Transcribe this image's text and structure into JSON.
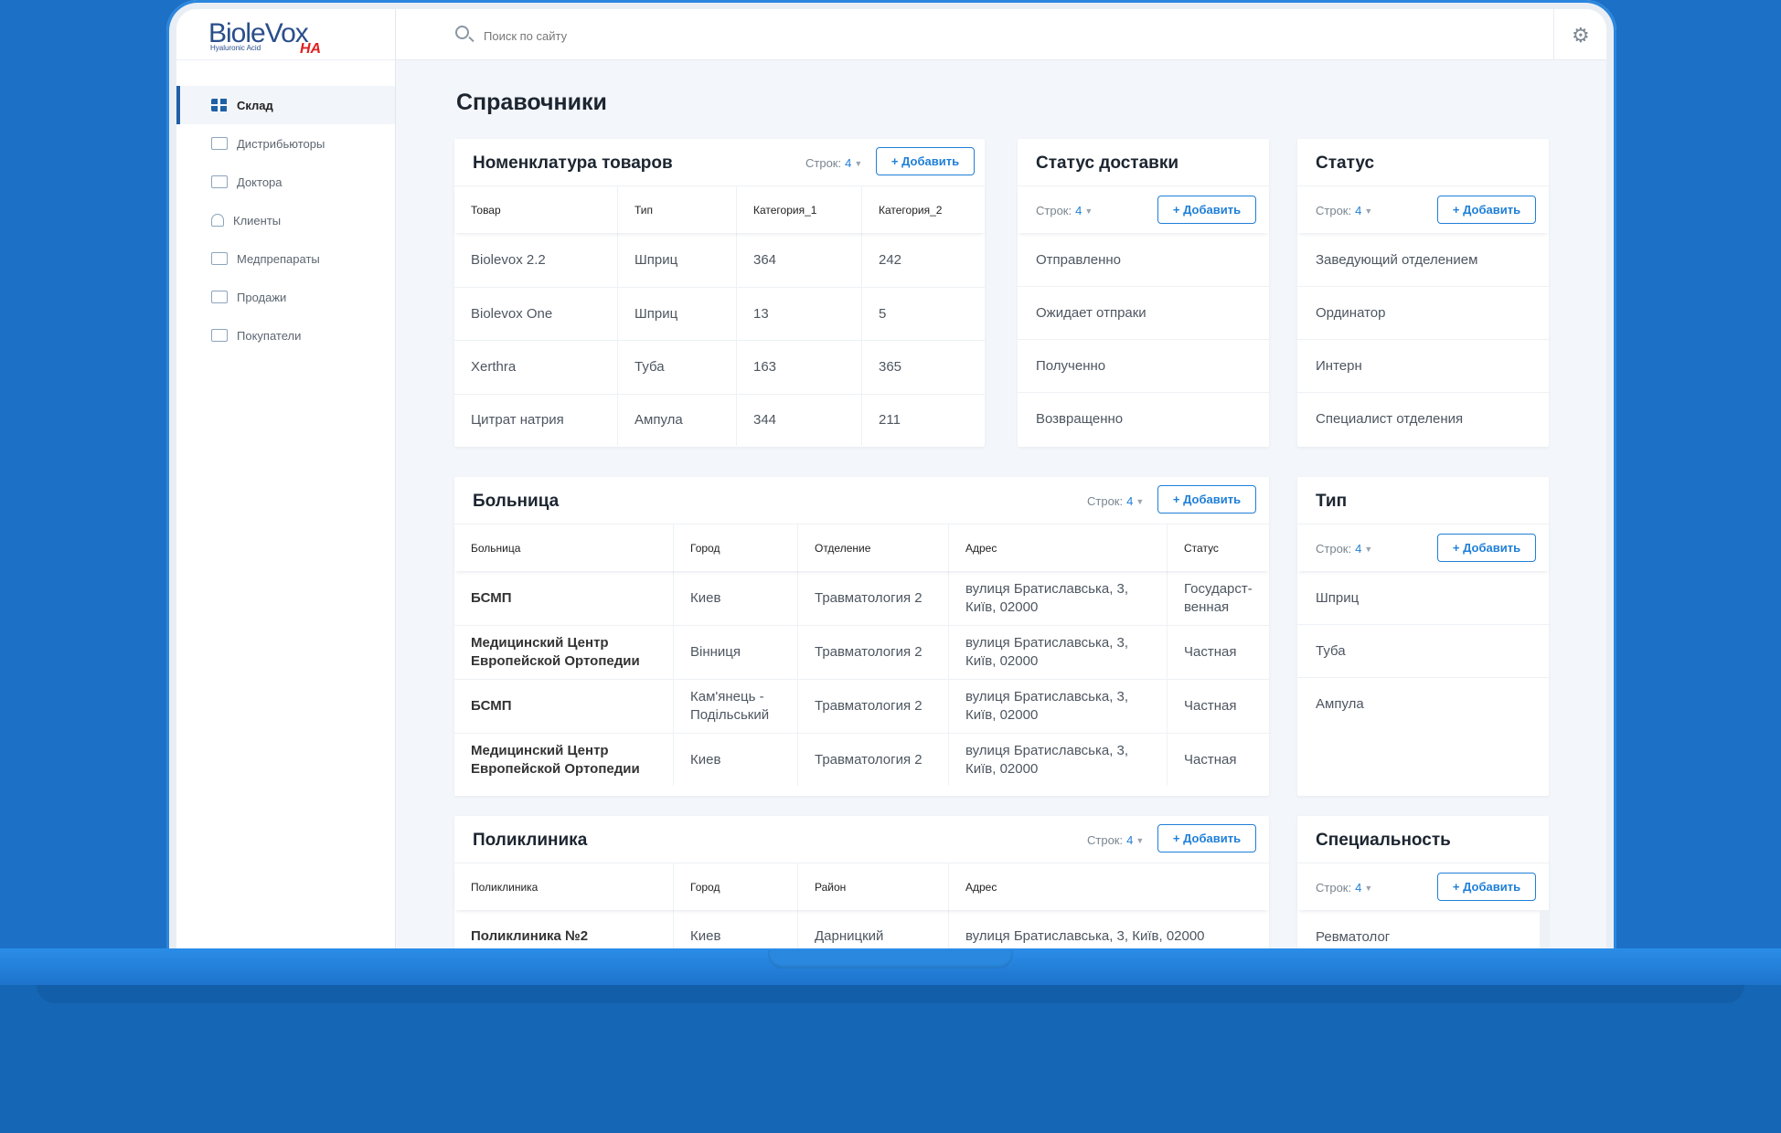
{
  "logo": {
    "main": "BioleVox",
    "sub": "Hyaluronic Acid",
    "ha": "HA"
  },
  "search": {
    "placeholder": "Поиск по сайту"
  },
  "sidebar": {
    "items": [
      {
        "label": "Склад",
        "icon": "grid-icon"
      },
      {
        "label": "Дистрибьюторы",
        "icon": "list-icon"
      },
      {
        "label": "Доктора",
        "icon": "mail-icon"
      },
      {
        "label": "Клиенты",
        "icon": "user-icon"
      },
      {
        "label": "Медпрепараты",
        "icon": "chat-icon"
      },
      {
        "label": "Продажи",
        "icon": "columns-icon"
      },
      {
        "label": "Покупатели",
        "icon": "columns-icon"
      }
    ]
  },
  "page_title": "Справочники",
  "common": {
    "rows_label": "Строк:",
    "rows_value": "4",
    "add_label": "+ Добавить"
  },
  "nomenclature": {
    "title": "Номенклатура товаров",
    "columns": [
      "Товар",
      "Тип",
      "Категория_1",
      "Категория_2"
    ],
    "rows": [
      [
        "Biolevox 2.2",
        "Шприц",
        "364",
        "242"
      ],
      [
        "Biolevox One",
        "Шприц",
        "13",
        "5"
      ],
      [
        "Xerthra",
        "Туба",
        "163",
        "365"
      ],
      [
        "Цитрат натрия",
        "Ампула",
        "344",
        "211"
      ]
    ]
  },
  "delivery_status": {
    "title": "Статус доставки",
    "items": [
      "Отправленно",
      "Ожидает отпраки",
      "Полученно",
      "Возвращенно"
    ]
  },
  "status": {
    "title": "Статус",
    "items": [
      "Заведующий отделением",
      "Ординатор",
      "Интерн",
      "Специалист отделения"
    ]
  },
  "hospital": {
    "title": "Больница",
    "columns": [
      "Больница",
      "Город",
      "Отделение",
      "Адрес",
      "Статус"
    ],
    "rows": [
      [
        "БСМП",
        "Киев",
        "Травматология 2",
        "вулиця Братиславська, 3, Київ, 02000",
        "Государст-венная"
      ],
      [
        "Медицинский Центр Европейской Ортопедии",
        "Вінниця",
        "Травматология 2",
        "вулиця Братиславська, 3, Київ, 02000",
        "Частная"
      ],
      [
        "БСМП",
        "Кам'янець - Подільський",
        "Травматология 2",
        "вулиця Братиславська, 3, Київ, 02000",
        "Частная"
      ],
      [
        "Медицинский Центр Европейской Ортопедии",
        "Киев",
        "Травматология 2",
        "вулиця Братиславська, 3, Київ, 02000",
        "Частная"
      ]
    ]
  },
  "type": {
    "title": "Тип",
    "items": [
      "Шприц",
      "Туба",
      "Ампула"
    ]
  },
  "polyclinic": {
    "title": "Поликлиника",
    "columns": [
      "Поликлиника",
      "Город",
      "Район",
      "Адрес"
    ],
    "rows": [
      [
        "Поликлиника №2",
        "Киев",
        "Дарницкий",
        "вулиця Братиславська, 3, Київ, 02000"
      ]
    ]
  },
  "specialty": {
    "title": "Специальность",
    "items": [
      "Ревматолог"
    ]
  }
}
